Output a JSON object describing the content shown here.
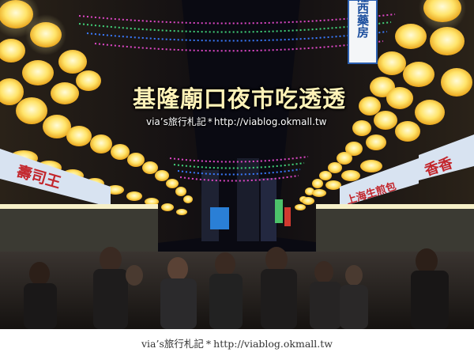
{
  "title": "基隆廟口夜市吃透透",
  "subtitle": {
    "brand": "via’s旅行札記",
    "star": "*",
    "url": "http://viablog.okmall.tw"
  },
  "footer": {
    "brand": "via’s旅行札記",
    "star": "*",
    "url": "http://viablog.okmall.tw"
  },
  "signs": {
    "vertical_sign": "隆西藥房",
    "left_shop_sign": "壽司王",
    "right_shop_sign_top": "香香",
    "right_shop_sign_mid": "上海生煎包",
    "right_shop_sign_low": "上海生煎包"
  },
  "colors": {
    "night_sky": "#0a0a12",
    "lantern": "#ffe46a",
    "lantern_glow": "#fff6b0",
    "title_text": "#fff3b8",
    "string_lights_pink": "#e048c8",
    "string_lights_green": "#42d37a",
    "string_lights_blue": "#3a7bff"
  }
}
